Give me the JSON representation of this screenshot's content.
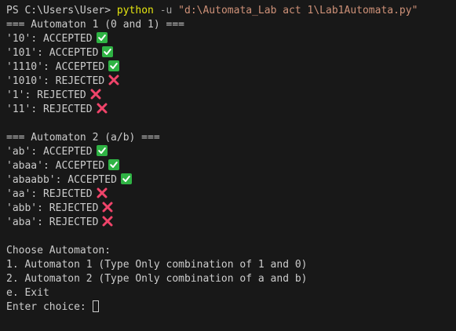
{
  "prompt": {
    "path": "PS C:\\Users\\User> ",
    "command": "python",
    "flag": "-u",
    "script": "\"d:\\Automata_Lab act 1\\Lab1Automata.py\""
  },
  "sections": [
    {
      "header": "=== Automaton 1 (0 and 1) ===",
      "results": [
        {
          "input": "'10'",
          "status": "ACCEPTED",
          "icon": "check-icon"
        },
        {
          "input": "'101'",
          "status": "ACCEPTED",
          "icon": "check-icon"
        },
        {
          "input": "'1110'",
          "status": "ACCEPTED",
          "icon": "check-icon"
        },
        {
          "input": "'1010'",
          "status": "REJECTED",
          "icon": "cross-icon"
        },
        {
          "input": "'1'",
          "status": "REJECTED",
          "icon": "cross-icon"
        },
        {
          "input": "'11'",
          "status": "REJECTED",
          "icon": "cross-icon"
        }
      ]
    },
    {
      "header": "=== Automaton 2 (a/b) ===",
      "results": [
        {
          "input": "'ab'",
          "status": "ACCEPTED",
          "icon": "check-icon"
        },
        {
          "input": "'abaa'",
          "status": "ACCEPTED",
          "icon": "check-icon"
        },
        {
          "input": "'abaabb'",
          "status": "ACCEPTED",
          "icon": "check-icon"
        },
        {
          "input": "'aa'",
          "status": "REJECTED",
          "icon": "cross-icon"
        },
        {
          "input": "'abb'",
          "status": "REJECTED",
          "icon": "cross-icon"
        },
        {
          "input": "'aba'",
          "status": "REJECTED",
          "icon": "cross-icon"
        }
      ]
    }
  ],
  "menu": {
    "title": "Choose Automaton:",
    "options": [
      "1. Automaton 1 (Type Only combination of 1 and 0)",
      "2. Automaton 2 (Type Only combination of a and b)",
      "e. Exit"
    ],
    "input_label": "Enter choice: ",
    "input_value": ""
  },
  "colors": {
    "background": "#181818",
    "text": "#cccccc",
    "command": "#e5e510",
    "flag": "#9d9d9d",
    "string": "#ce9178",
    "accepted": "#2fb344",
    "rejected": "#f0446a"
  }
}
